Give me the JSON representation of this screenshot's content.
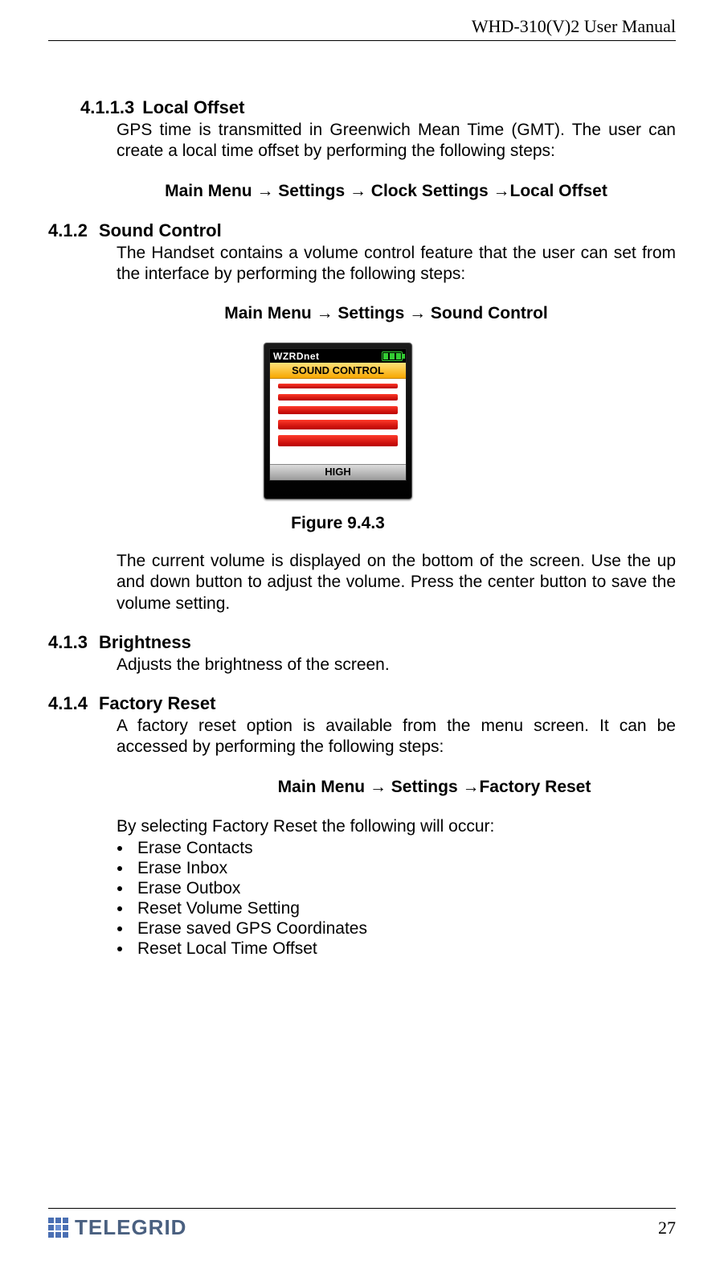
{
  "header": {
    "title": "WHD-310(V)2 User Manual"
  },
  "sections": {
    "s_4113": {
      "num": "4.1.1.3",
      "title": "Local Offset",
      "body": "GPS time is transmitted in Greenwich Mean Time (GMT).  The user can create a local time offset by performing the following steps:",
      "path": "Main Menu → Settings → Clock Settings →Local Offset"
    },
    "s_412": {
      "num": "4.1.2",
      "title": "Sound Control",
      "body": "The Handset contains a volume control feature that the user can set from the interface by performing the following steps:",
      "path": "Main Menu → Settings → Sound Control",
      "figure_caption": "Figure 9.4.3",
      "body2": "The current volume is displayed on the bottom of the screen.  Use the up and down button to adjust the volume.  Press the center button to save the volume setting."
    },
    "s_413": {
      "num": "4.1.3",
      "title": "Brightness",
      "body": "Adjusts the brightness of the screen."
    },
    "s_414": {
      "num": "4.1.4",
      "title": "Factory Reset",
      "body": "A factory reset option is available from the menu screen.  It can be accessed by performing the following steps:",
      "path": "Main Menu → Settings →Factory Reset",
      "body2": "By selecting Factory Reset the following will occur:",
      "bullets": [
        "Erase Contacts",
        "Erase Inbox",
        "Erase Outbox",
        "Reset Volume Setting",
        "Erase saved GPS Coordinates",
        "Reset Local Time Offset"
      ]
    }
  },
  "device": {
    "network": "WZRDnet",
    "screen_title": "SOUND CONTROL",
    "level_label": "HIGH"
  },
  "footer": {
    "logo_text": "TELEGRID",
    "page_number": "27"
  }
}
